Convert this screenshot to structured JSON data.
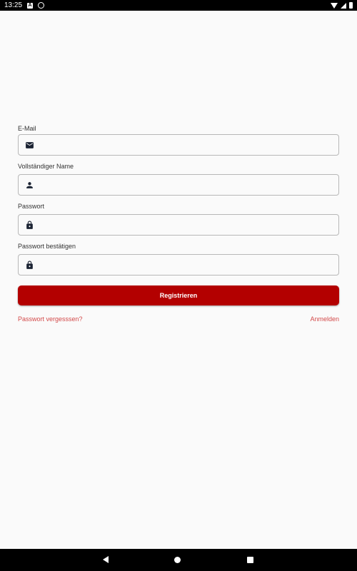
{
  "status_bar": {
    "time": "13:25",
    "icons": [
      "a-notification-icon",
      "sync-icon",
      "wifi-icon",
      "signal-icon",
      "battery-icon"
    ]
  },
  "form": {
    "fields": [
      {
        "label": "E-Mail",
        "value": "",
        "icon": "email-icon"
      },
      {
        "label": "Vollständiger Name",
        "value": "",
        "icon": "person-icon"
      },
      {
        "label": "Passwort",
        "value": "",
        "icon": "lock-icon"
      },
      {
        "label": "Passwort bestätigen",
        "value": "",
        "icon": "lock-icon"
      }
    ],
    "submit_label": "Registrieren",
    "forgot_password_label": "Passwort vergesssen?",
    "login_label": "Anmelden"
  },
  "colors": {
    "accent": "#b30000",
    "link": "#d34a4a",
    "background": "#fafafa"
  },
  "nav_bar": {
    "buttons": [
      "back-icon",
      "home-icon",
      "recents-icon"
    ]
  }
}
